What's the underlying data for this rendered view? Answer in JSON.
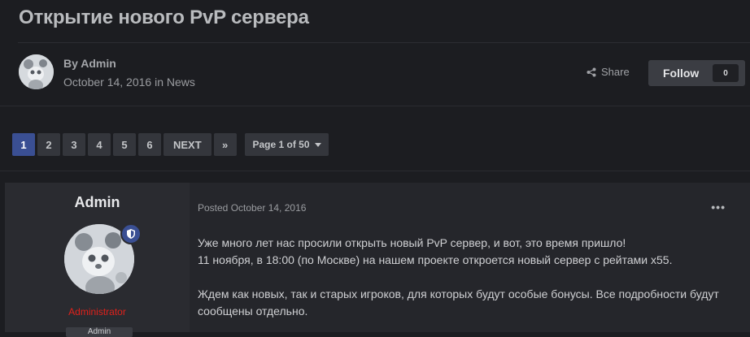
{
  "page": {
    "title": "Открытие нового PvP сервера"
  },
  "author_meta": {
    "by_label": "By Admin",
    "date": "October 14, 2016",
    "in_text": " in ",
    "category": "News"
  },
  "actions": {
    "share_label": "Share",
    "follow_label": "Follow",
    "follow_count": "0"
  },
  "pagination": {
    "pages": [
      "1",
      "2",
      "3",
      "4",
      "5",
      "6"
    ],
    "active_page": "1",
    "next_label": "NEXT",
    "last_label": "»",
    "page_of": "Page 1 of 50"
  },
  "post": {
    "author_name": "Admin",
    "author_role": "Administrator",
    "role_badge": "Admin",
    "posted_label": "Posted October 14, 2016",
    "more_label": "•••",
    "paragraphs": [
      "Уже много лет нас просили открыть новый PvP сервер, и вот, это время пришло!",
      "11 ноября, в 18:00 (по Москве) на нашем проекте откроется новый сервер с рейтами x55.",
      "Ждем как новых, так и старых игроков, для которых будут особые бонусы. Все подробности будут сообщены отдельно."
    ]
  },
  "colors": {
    "background": "#1c1d21",
    "accent": "#3a4f93",
    "role_red": "#e0211b"
  },
  "icons": [
    "share-icon",
    "chevron-down-icon",
    "shield-icon",
    "more-options-icon"
  ]
}
